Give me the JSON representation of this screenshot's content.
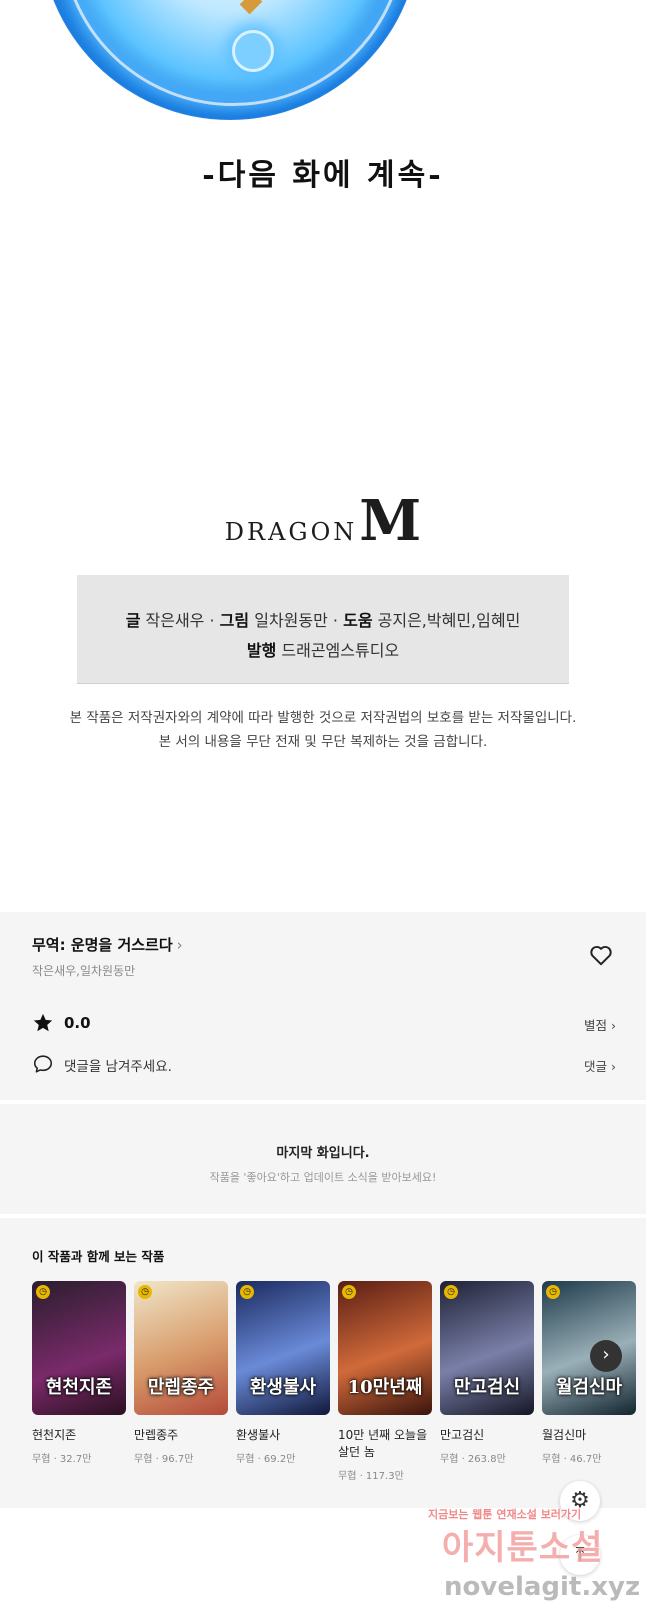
{
  "panel": {
    "continue_text": "-다음 화에 계속-",
    "logo_word": "DRAGON",
    "logo_letter": "M",
    "credits": {
      "story_label": "글",
      "story": "작은새우",
      "art_label": "그림",
      "art": "일차원동만",
      "assist_label": "도움",
      "assist": "공지은,박혜민,임혜민",
      "publisher_label": "발행",
      "publisher": "드래곤엠스튜디오",
      "sep": " · "
    },
    "copyright_line1": "본 작품은 저작권자와의 계약에 따라 발행한 것으로 저작권법의 보호를 받는 저작물입니다.",
    "copyright_line2": "본 서의 내용을 무단 전재 및 무단 복제하는 것을 금합니다."
  },
  "info": {
    "title": "무역: 운명을 거스르다",
    "chevron": "›",
    "authors": "작은새우,일차원동만",
    "rating": "0.0",
    "rating_link": "별점 ›",
    "comment_prompt": "댓글을 남겨주세요.",
    "comment_link": "댓글 ›"
  },
  "last_episode": {
    "title": "마지막 화입니다.",
    "subtitle": "작품을 '좋아요'하고 업데이트 소식을 받아보세요!"
  },
  "recommendations": {
    "title": "이 작품과 함께 보는 작품",
    "items": [
      {
        "name": "현천지존",
        "stats": "무협 · 32.7만",
        "thumb_text": "현천지존",
        "colors": [
          "#2a1e2e",
          "#7a2a6a"
        ]
      },
      {
        "name": "만렙종주",
        "stats": "무협 · 96.7만",
        "thumb_text": "만렙종주",
        "colors": [
          "#efe6c8",
          "#b34a3a"
        ]
      },
      {
        "name": "환생불사",
        "stats": "무협 · 69.2만",
        "thumb_text": "환생불사",
        "colors": [
          "#1b2a5e",
          "#6a8ad8"
        ]
      },
      {
        "name": "10만 년째 오늘을 살던 놈",
        "stats": "무협 · 117.3만",
        "thumb_text": "10만년째",
        "colors": [
          "#5a1e14",
          "#d06a3a"
        ]
      },
      {
        "name": "만고검신",
        "stats": "무협 · 263.8만",
        "thumb_text": "만고검신",
        "colors": [
          "#1e2236",
          "#7a7fa8"
        ]
      },
      {
        "name": "월검신마",
        "stats": "무협 · 46.7만",
        "thumb_text": "월검신마",
        "colors": [
          "#1e3a4a",
          "#9ab0b8"
        ]
      }
    ],
    "next_label": "›"
  },
  "floating": {
    "settings_icon": "⚙",
    "top_icon": "⤒"
  },
  "watermark": {
    "line1": "지금보는 웹툰 연재소설 보러가기",
    "line2": "아지툰소설",
    "line3": "novelagit.xyz"
  }
}
